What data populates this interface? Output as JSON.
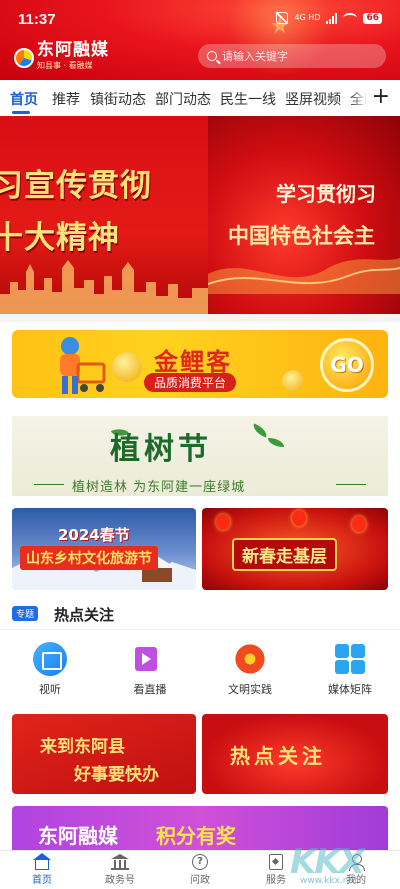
{
  "status_bar": {
    "time": "11:37",
    "network": "4G HD",
    "battery": "66"
  },
  "header": {
    "app_name": "东阿融媒",
    "slogan": "知县事 · 看融媒",
    "search_placeholder": "请输入关键字",
    "brand_color": "#e8141c"
  },
  "tabs": {
    "items": [
      {
        "label": "首页"
      },
      {
        "label": "推荐"
      },
      {
        "label": "镇街动态"
      },
      {
        "label": "部门动态"
      },
      {
        "label": "民生一线"
      },
      {
        "label": "竖屏视频"
      },
      {
        "label": "全国"
      }
    ],
    "active_color": "#1a5fdc",
    "add_icon": "plus-icon"
  },
  "carousel": {
    "slide1_line1": "习宣传贯彻",
    "slide1_line2": "十大精神",
    "slide2_line1": "学习贯彻习",
    "slide2_line2": "中国特色社会主",
    "slide_count": 13,
    "active_index": 6
  },
  "promo": {
    "title": "金鲤客",
    "subtitle": "品质消费平台",
    "go_label": "GO"
  },
  "tree_festival": {
    "title": "植树节",
    "slogan": "植树造林  为东阿建一座绿城"
  },
  "cards": {
    "left_line1": "2024春节",
    "left_line2": "山东乡村文化旅游节",
    "right_title": "新春走基层"
  },
  "hot_topics": {
    "badge": "专题",
    "title": "热点关注",
    "features": [
      {
        "label": "视听",
        "icon": "video-icon"
      },
      {
        "label": "看直播",
        "icon": "live-icon"
      },
      {
        "label": "文明实践",
        "icon": "civilization-icon"
      },
      {
        "label": "媒体矩阵",
        "icon": "matrix-icon"
      }
    ]
  },
  "bottom_cards": {
    "left_line1": "来到东阿县",
    "left_line2": "好事要快办",
    "right_title": "热点关注"
  },
  "points_banner": {
    "part1": "东阿融媒",
    "part2": "积分有奖"
  },
  "bottom_nav": {
    "items": [
      {
        "label": "首页",
        "icon": "home-icon"
      },
      {
        "label": "政务号",
        "icon": "bank-icon"
      },
      {
        "label": "问政",
        "icon": "question-icon"
      },
      {
        "label": "服务",
        "icon": "service-icon"
      },
      {
        "label": "我的",
        "icon": "user-icon"
      }
    ]
  },
  "watermark": {
    "text": "KKX",
    "site": "www.kkx.net"
  }
}
